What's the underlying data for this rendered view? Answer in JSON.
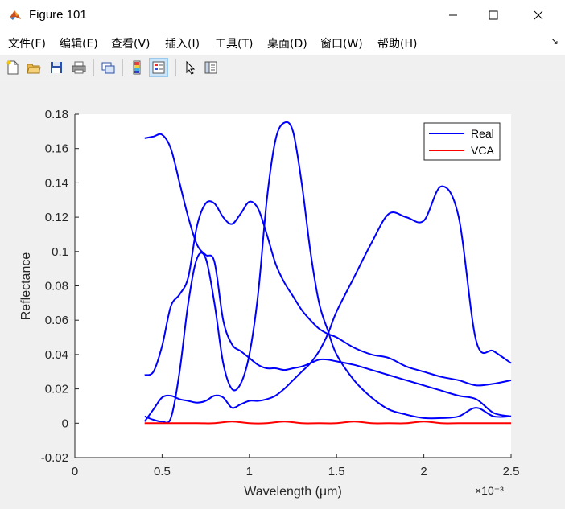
{
  "window": {
    "title": "Figure 101"
  },
  "menu": {
    "items": [
      "文件(F)",
      "编辑(E)",
      "查看(V)",
      "插入(I)",
      "工具(T)",
      "桌面(D)",
      "窗口(W)",
      "帮助(H)"
    ]
  },
  "toolbar": {
    "icons": [
      "new-figure-icon",
      "open-file-icon",
      "save-icon",
      "print-icon",
      "link-plot-icon",
      "insert-colorbar-icon",
      "insert-legend-icon",
      "edit-plot-icon",
      "property-inspector-icon"
    ]
  },
  "chart_data": {
    "type": "line",
    "xlabel": "Wavelength (μm)",
    "ylabel": "Reflectance",
    "x_exponent": "×10⁻³",
    "xlim": [
      0,
      2.5
    ],
    "ylim": [
      -0.02,
      0.18
    ],
    "xticks": [
      0,
      0.5,
      1,
      1.5,
      2,
      2.5
    ],
    "xtick_labels": [
      "0",
      "0.5",
      "1",
      "1.5",
      "2",
      "2.5"
    ],
    "yticks": [
      -0.02,
      0,
      0.02,
      0.04,
      0.06,
      0.08,
      0.1,
      0.12,
      0.14,
      0.16,
      0.18
    ],
    "ytick_labels": [
      "-0.02",
      "0",
      "0.02",
      "0.04",
      "0.06",
      "0.08",
      "0.1",
      "0.12",
      "0.14",
      "0.16",
      "0.18"
    ],
    "grid": false,
    "legend": {
      "position": "top-right",
      "entries": [
        {
          "label": "Real",
          "color": "#0000ff"
        },
        {
          "label": "VCA",
          "color": "#ff0000"
        }
      ]
    },
    "series": [
      {
        "name": "Real",
        "color": "#0000ff",
        "x": [
          0.4,
          0.45,
          0.5,
          0.55,
          0.6,
          0.65,
          0.7,
          0.75,
          0.8,
          0.85,
          0.9,
          0.95,
          1.0,
          1.05,
          1.1,
          1.15,
          1.2,
          1.25,
          1.3,
          1.35,
          1.4,
          1.45,
          1.5,
          1.6,
          1.7,
          1.8,
          1.9,
          2.0,
          2.1,
          2.2,
          2.3,
          2.4,
          2.5
        ],
        "y": [
          0.166,
          0.167,
          0.168,
          0.16,
          0.14,
          0.12,
          0.104,
          0.098,
          0.094,
          0.06,
          0.046,
          0.042,
          0.038,
          0.034,
          0.032,
          0.032,
          0.031,
          0.032,
          0.033,
          0.035,
          0.037,
          0.037,
          0.036,
          0.034,
          0.031,
          0.028,
          0.025,
          0.022,
          0.019,
          0.016,
          0.014,
          0.006,
          0.004
        ]
      },
      {
        "name": "Real",
        "color": "#0000ff",
        "x": [
          0.4,
          0.45,
          0.5,
          0.55,
          0.6,
          0.65,
          0.7,
          0.75,
          0.8,
          0.85,
          0.9,
          0.95,
          1.0,
          1.05,
          1.1,
          1.15,
          1.2,
          1.25,
          1.3,
          1.35,
          1.4,
          1.45,
          1.5,
          1.6,
          1.7,
          1.8,
          1.9,
          2.0,
          2.1,
          2.2,
          2.3,
          2.4,
          2.5
        ],
        "y": [
          0.028,
          0.03,
          0.045,
          0.068,
          0.075,
          0.085,
          0.115,
          0.128,
          0.128,
          0.12,
          0.116,
          0.122,
          0.129,
          0.125,
          0.11,
          0.093,
          0.082,
          0.074,
          0.066,
          0.06,
          0.055,
          0.052,
          0.05,
          0.044,
          0.04,
          0.038,
          0.033,
          0.03,
          0.027,
          0.025,
          0.022,
          0.023,
          0.025
        ]
      },
      {
        "name": "Real",
        "color": "#0000ff",
        "x": [
          0.4,
          0.45,
          0.5,
          0.55,
          0.6,
          0.65,
          0.7,
          0.75,
          0.8,
          0.85,
          0.9,
          0.95,
          1.0,
          1.05,
          1.1,
          1.15,
          1.2,
          1.25,
          1.3,
          1.35,
          1.4,
          1.45,
          1.5,
          1.6,
          1.7,
          1.8,
          1.9,
          2.0,
          2.1,
          2.2,
          2.3,
          2.4,
          2.5
        ],
        "y": [
          0.004,
          0.002,
          0.001,
          0.003,
          0.03,
          0.07,
          0.096,
          0.096,
          0.07,
          0.035,
          0.02,
          0.023,
          0.04,
          0.075,
          0.13,
          0.165,
          0.175,
          0.17,
          0.14,
          0.1,
          0.07,
          0.054,
          0.04,
          0.025,
          0.015,
          0.008,
          0.005,
          0.003,
          0.003,
          0.004,
          0.009,
          0.004,
          0.004
        ]
      },
      {
        "name": "Real",
        "color": "#0000ff",
        "x": [
          0.4,
          0.45,
          0.5,
          0.55,
          0.6,
          0.65,
          0.7,
          0.75,
          0.8,
          0.85,
          0.9,
          0.95,
          1.0,
          1.05,
          1.1,
          1.15,
          1.2,
          1.25,
          1.3,
          1.35,
          1.4,
          1.45,
          1.5,
          1.6,
          1.7,
          1.8,
          1.9,
          2.0,
          2.1,
          2.2,
          2.3,
          2.4,
          2.5
        ],
        "y": [
          0.001,
          0.008,
          0.015,
          0.016,
          0.014,
          0.013,
          0.012,
          0.013,
          0.016,
          0.015,
          0.009,
          0.011,
          0.013,
          0.013,
          0.014,
          0.016,
          0.02,
          0.025,
          0.03,
          0.035,
          0.042,
          0.052,
          0.065,
          0.085,
          0.105,
          0.122,
          0.12,
          0.118,
          0.138,
          0.12,
          0.048,
          0.042,
          0.035
        ]
      },
      {
        "name": "VCA",
        "color": "#ff0000",
        "x": [
          0.4,
          0.5,
          0.6,
          0.7,
          0.8,
          0.9,
          1.0,
          1.1,
          1.2,
          1.3,
          1.4,
          1.5,
          1.6,
          1.7,
          1.8,
          1.9,
          2.0,
          2.1,
          2.2,
          2.3,
          2.4,
          2.5
        ],
        "y": [
          0.0,
          0.0,
          0.0,
          0.0,
          0.0,
          0.001,
          0.0,
          0.0,
          0.001,
          0.0,
          0.0,
          0.0,
          0.001,
          0.0,
          0.0,
          0.0,
          0.001,
          0.0,
          0.0,
          0.0,
          0.0,
          0.0
        ]
      }
    ]
  }
}
